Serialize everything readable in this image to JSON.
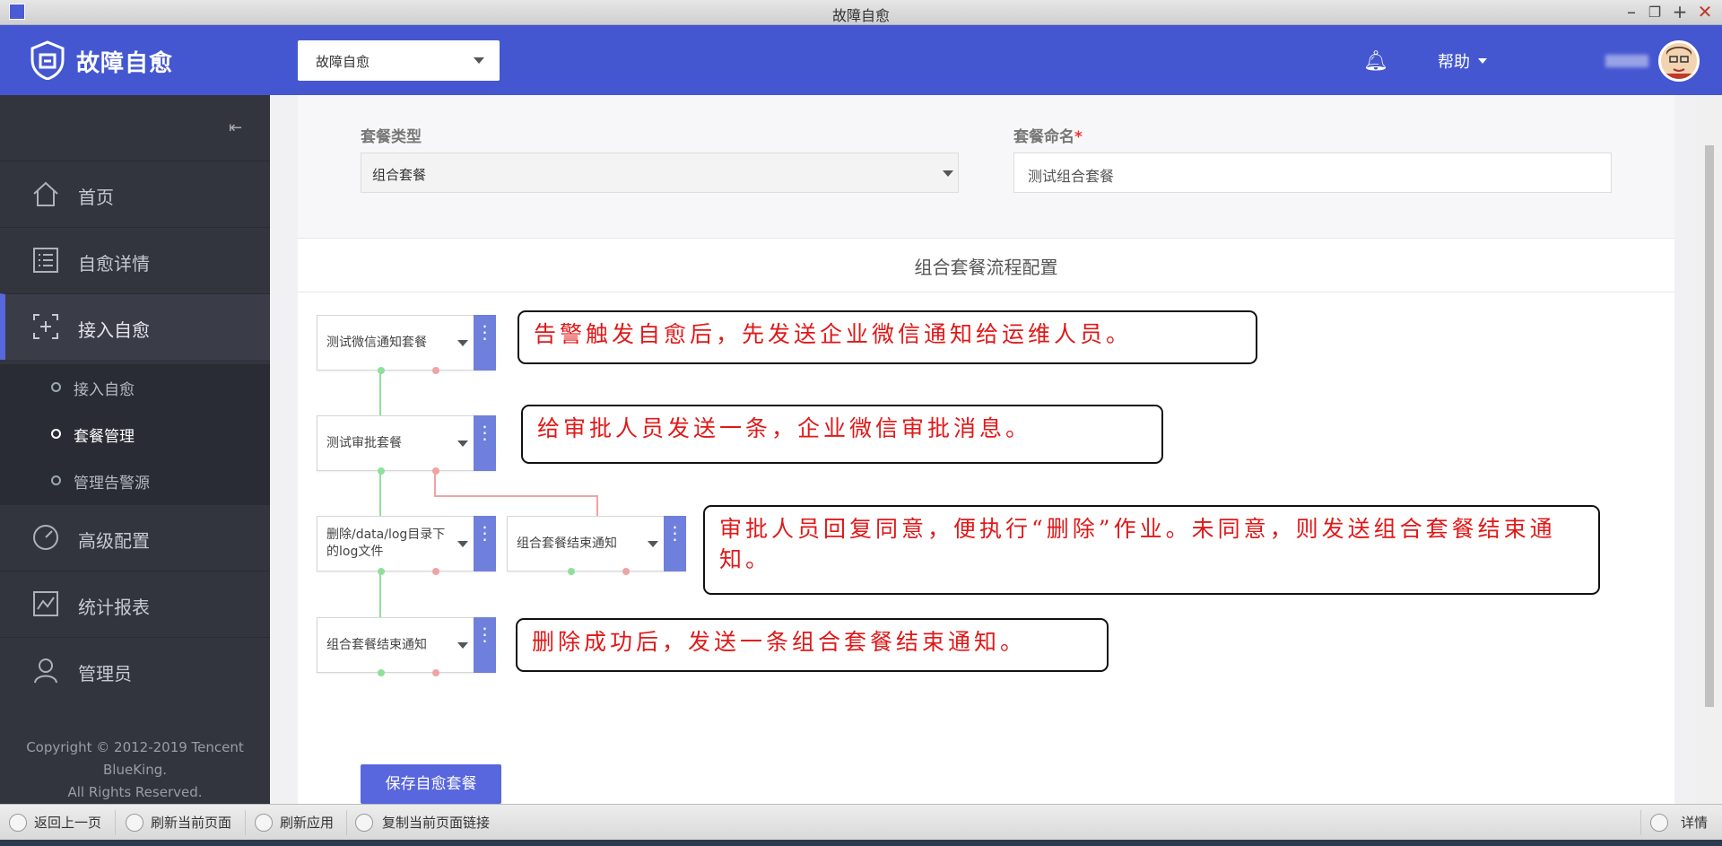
{
  "window": {
    "title": "故障自愈"
  },
  "header": {
    "brand": "故障自愈",
    "app_select": "故障自愈",
    "help": "帮助"
  },
  "sidebar": {
    "items": [
      {
        "label": "首页",
        "icon": "home-icon"
      },
      {
        "label": "自愈详情",
        "icon": "list-icon"
      },
      {
        "label": "接入自愈",
        "icon": "access-icon"
      },
      {
        "label": "高级配置",
        "icon": "gauge-icon"
      },
      {
        "label": "统计报表",
        "icon": "chart-icon"
      },
      {
        "label": "管理员",
        "icon": "user-icon"
      }
    ],
    "sub_items": [
      {
        "label": "接入自愈"
      },
      {
        "label": "套餐管理"
      },
      {
        "label": "管理告警源"
      }
    ],
    "copyright_lines": [
      "Copyright © 2012-2019 Tencent",
      "BlueKing.",
      "All Rights Reserved."
    ]
  },
  "form": {
    "package_type_label": "套餐类型",
    "package_type_value": "组合套餐",
    "package_name_label": "套餐命名",
    "package_name_required": "*",
    "package_name_value": "测试组合套餐"
  },
  "flow": {
    "title": "组合套餐流程配置",
    "nodes": [
      {
        "label": "测试微信通知套餐"
      },
      {
        "label": "测试审批套餐"
      },
      {
        "label": "删除/data/log目录下的log文件"
      },
      {
        "label": "组合套餐结束通知"
      },
      {
        "label": "组合套餐结束通知"
      }
    ],
    "menu_glyph": "⋮"
  },
  "annotations": [
    "告警触发自愈后，先发送企业微信通知给运维人员。",
    "给审批人员发送一条，企业微信审批消息。",
    "审批人员回复同意，便执行“删除”作业。未同意，则发送组合套餐结束通知。",
    "删除成功后，发送一条组合套餐结束通知。"
  ],
  "save_button": "保存自愈套餐",
  "statusbar": {
    "back": "返回上一页",
    "refresh_page": "刷新当前页面",
    "refresh_app": "刷新应用",
    "copy_link": "复制当前页面链接",
    "details": "详情"
  },
  "colors": {
    "primary": "#4457d1",
    "sidebar_bg": "#32343e",
    "annotation_text": "#e01818",
    "success_line": "#8fe09a",
    "fail_line": "#f1a3a3"
  }
}
